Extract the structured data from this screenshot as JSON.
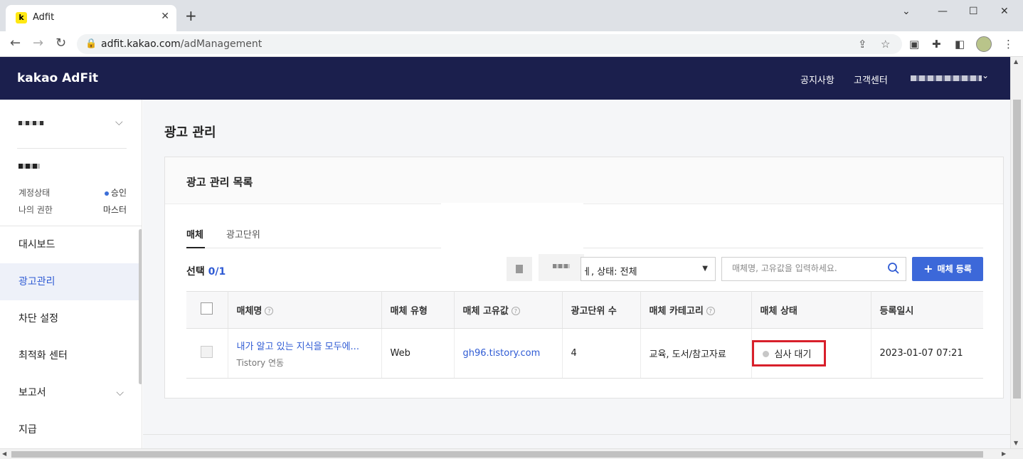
{
  "browser": {
    "tab_title": "Adfit",
    "favicon_letter": "k",
    "new_tab": "+",
    "url_host": "adfit.kakao.com",
    "url_path": "/adManagement",
    "window_controls": [
      "⌄",
      "—",
      "☐",
      "✕"
    ]
  },
  "header": {
    "logo": "kakao AdFit",
    "links": [
      "공지사항",
      "고객센터"
    ],
    "user_chevron": "⌄",
    "bg_color": "#1b1f4d"
  },
  "sidebar": {
    "account_status_label": "계정상태",
    "account_status_value": "승인",
    "permission_label": "나의 권한",
    "permission_value": "마스터",
    "menu": [
      {
        "label": "대시보드",
        "active": false
      },
      {
        "label": "광고관리",
        "active": true
      },
      {
        "label": "차단 설정",
        "active": false
      },
      {
        "label": "최적화 센터",
        "active": false
      },
      {
        "label": "보고서",
        "active": false
      },
      {
        "label": "지급",
        "active": false
      }
    ]
  },
  "main": {
    "page_title": "광고 관리",
    "card_title": "광고 관리 목록",
    "tabs": [
      "매체",
      "광고단위"
    ],
    "selection_label": "선택",
    "selection_count": "0/1",
    "filter_value": "ㅔ, 상태: 전체",
    "search_placeholder": "매체명, 고유값을 입력하세요.",
    "register_button": "매체 등록"
  },
  "table": {
    "columns": [
      "매체명",
      "매체 유형",
      "매체 고유값",
      "광고단위 수",
      "매체 카테고리",
      "매체 상태",
      "등록일시"
    ],
    "rows": [
      {
        "name": "내가 알고 있는 지식을 모두에...",
        "name_sub": "Tistory 연동",
        "type": "Web",
        "id": "gh96.tistory.com",
        "unit_count": "4",
        "category": "교육, 도서/참고자료",
        "status": "심사 대기",
        "registered": "2023-01-07 07:21"
      }
    ]
  },
  "colors": {
    "accent": "#3c68d9",
    "highlight_box": "#d8202b",
    "status_pending": "#c7c7c7"
  }
}
